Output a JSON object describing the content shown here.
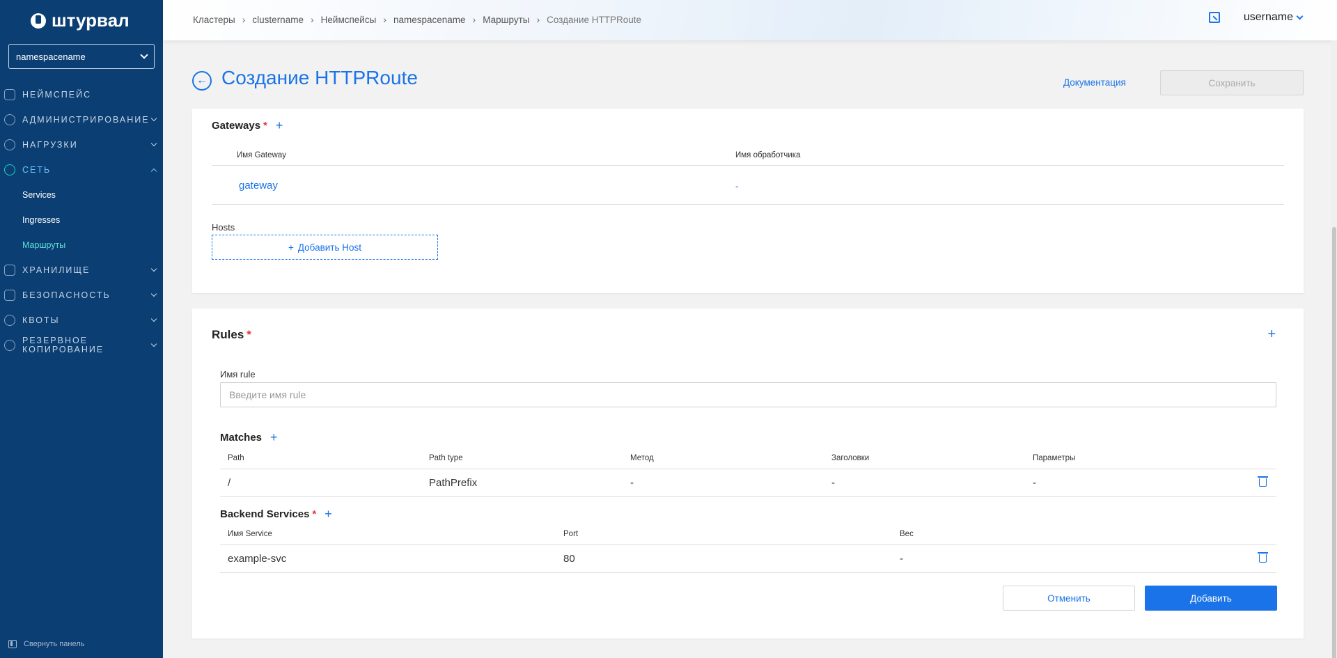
{
  "sidebar": {
    "logo_text": "штурвал",
    "namespace_select": "namespacename",
    "items": [
      {
        "label": "Неймспейс"
      },
      {
        "label": "Администрирование"
      },
      {
        "label": "Нагрузки"
      },
      {
        "label": "Сеть"
      },
      {
        "label": "Хранилище"
      },
      {
        "label": "Безопасность"
      },
      {
        "label": "Квоты"
      },
      {
        "label": "Резервное копирование"
      }
    ],
    "network_subitems": [
      {
        "label": "Services"
      },
      {
        "label": "Ingresses"
      },
      {
        "label": "Маршруты"
      }
    ],
    "collapse_label": "Свернуть панель"
  },
  "header": {
    "breadcrumbs": [
      "Кластеры",
      "clustername",
      "Неймспейсы",
      "namespacename",
      "Маршруты",
      "Создание HTTPRoute"
    ],
    "username": "username"
  },
  "main": {
    "title": "Создание HTTPRoute",
    "doc_link": "Документация",
    "save_label": "Сохранить",
    "gateways": {
      "title": "Gateways",
      "columns": [
        "Имя Gateway",
        "Имя обработчика"
      ],
      "rows": [
        {
          "name": "gateway",
          "handler": "-"
        }
      ]
    },
    "hosts": {
      "label": "Hosts",
      "add_label": "Добавить Host"
    },
    "rules": {
      "title": "Rules",
      "rule_name_label": "Имя rule",
      "rule_name_placeholder": "Введите имя rule",
      "matches": {
        "title": "Matches",
        "columns": [
          "Path",
          "Path type",
          "Метод",
          "Заголовки",
          "Параметры"
        ],
        "rows": [
          {
            "path": "/",
            "path_type": "PathPrefix",
            "method": "-",
            "headers": "-",
            "params": "-"
          }
        ]
      },
      "backends": {
        "title": "Backend Services",
        "columns": [
          "Имя Service",
          "Port",
          "Вес"
        ],
        "rows": [
          {
            "name": "example-svc",
            "port": "80",
            "weight": "-"
          }
        ]
      },
      "cancel_label": "Отменить",
      "add_label": "Добавить"
    }
  },
  "colors": {
    "sidebar_bg": "#0b3e73",
    "accent": "#1a73e8",
    "active_teal": "#5ce0d8",
    "required": "#e53935"
  }
}
